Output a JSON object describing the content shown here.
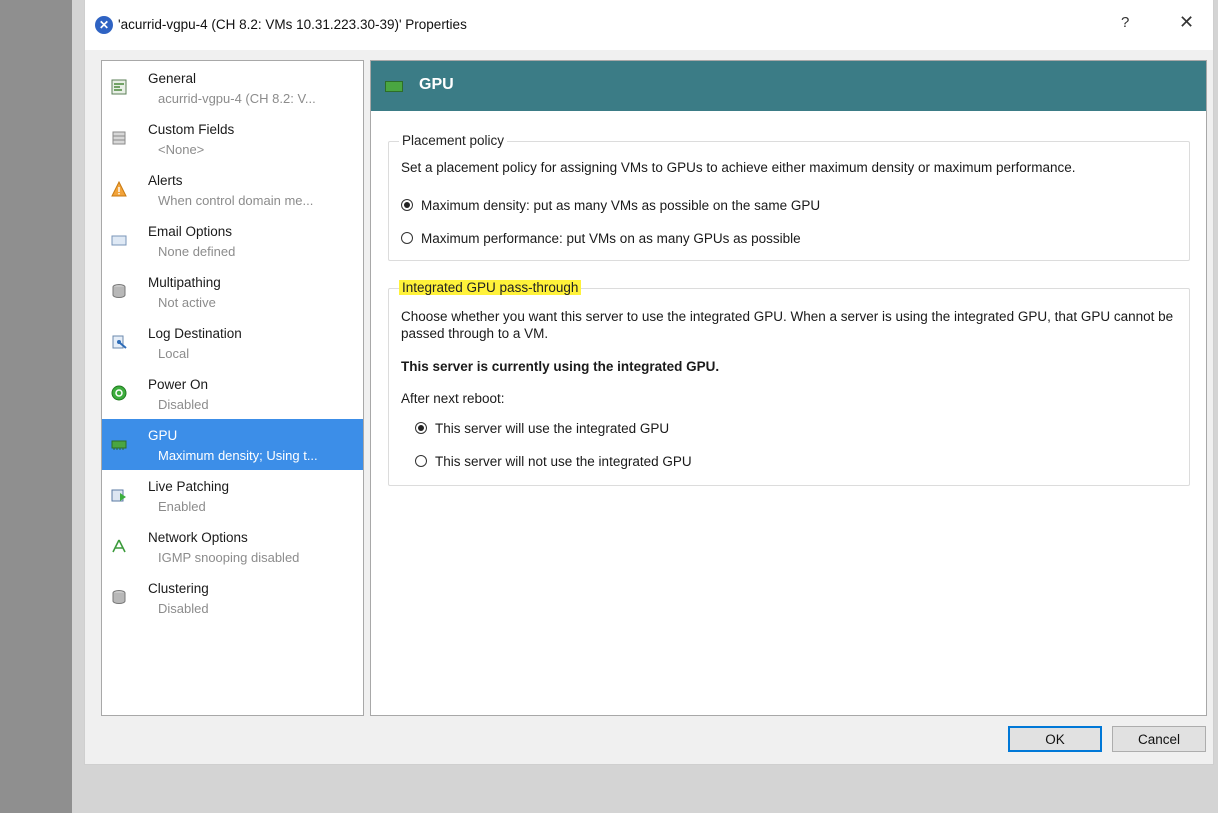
{
  "window": {
    "title": "'acurrid-vgpu-4 (CH 8.2: VMs 10.31.223.30-39)' Properties",
    "help_label": "?",
    "close_label": "✕"
  },
  "sidebar": {
    "items": [
      {
        "title": "General",
        "subtitle": "acurrid-vgpu-4 (CH 8.2: V...",
        "icon": "general-icon",
        "selected": false
      },
      {
        "title": "Custom Fields",
        "subtitle": "<None>",
        "icon": "custom-fields-icon",
        "selected": false
      },
      {
        "title": "Alerts",
        "subtitle": "When control domain me...",
        "icon": "alert-icon",
        "selected": false
      },
      {
        "title": "Email Options",
        "subtitle": "None defined",
        "icon": "email-icon",
        "selected": false
      },
      {
        "title": "Multipathing",
        "subtitle": "Not active",
        "icon": "disk-icon",
        "selected": false
      },
      {
        "title": "Log Destination",
        "subtitle": "Local",
        "icon": "log-icon",
        "selected": false
      },
      {
        "title": "Power On",
        "subtitle": "Disabled",
        "icon": "power-icon",
        "selected": false
      },
      {
        "title": "GPU",
        "subtitle": "Maximum density; Using t...",
        "icon": "gpu-icon",
        "selected": true
      },
      {
        "title": "Live Patching",
        "subtitle": "Enabled",
        "icon": "patch-icon",
        "selected": false
      },
      {
        "title": "Network Options",
        "subtitle": "IGMP snooping disabled",
        "icon": "network-icon",
        "selected": false
      },
      {
        "title": "Clustering",
        "subtitle": "Disabled",
        "icon": "cluster-icon",
        "selected": false
      }
    ]
  },
  "content": {
    "header_title": "GPU",
    "placement": {
      "legend": "Placement policy",
      "description": "Set a placement policy for assigning VMs to GPUs to achieve either maximum density or maximum performance.",
      "option_density": "Maximum density: put as many VMs as possible on the same GPU",
      "option_performance": "Maximum performance: put VMs on as many GPUs as possible",
      "selected": "density"
    },
    "integrated": {
      "legend": "Integrated GPU pass-through",
      "description": "Choose whether you want this server to use the integrated GPU. When a server is using the integrated GPU, that GPU cannot be passed through to a VM.",
      "status": "This server is currently using the integrated GPU.",
      "after_reboot": "After next reboot:",
      "option_use": "This server will use the integrated GPU",
      "option_not_use": "This server will not use the integrated GPU",
      "selected": "use"
    }
  },
  "buttons": {
    "ok": "OK",
    "cancel": "Cancel"
  },
  "colors": {
    "header": "#3b7c86",
    "selection": "#3c8ee8",
    "highlight": "#fff23a"
  }
}
